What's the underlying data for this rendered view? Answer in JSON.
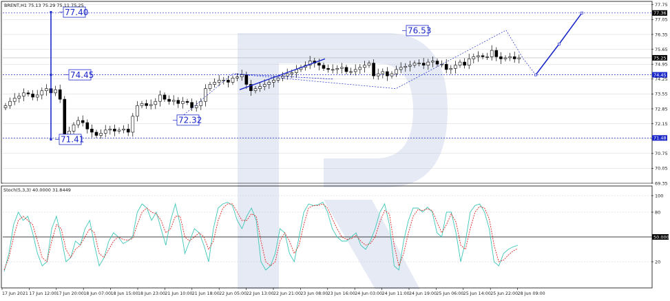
{
  "header": {
    "main_label": "BRENT,H1  75.13 75.29 75.11 75.25",
    "stoch_label": "Stoch(5,3,3) 40.0000 31.8449"
  },
  "colors": {
    "candle": "#000000",
    "level": "#1a27c9",
    "stoch_k": "#3cc7b7",
    "stoch_d": "#e0231c",
    "grid": "#c8c8c8",
    "watermark": "#e6eaf5"
  },
  "chart_data": [
    {
      "type": "candlestick",
      "title": "BRENT,H1",
      "ohlc_last": {
        "open": 75.13,
        "high": 75.29,
        "low": 75.11,
        "close": 75.25
      },
      "ylim": [
        69.35,
        77.84
      ],
      "y_ticks": [
        69.35,
        70.05,
        70.75,
        71.45,
        72.15,
        72.85,
        73.55,
        74.25,
        74.95,
        75.65,
        76.35,
        77.05,
        77.75
      ],
      "x_ticks": [
        "17 Jun 2021",
        "17 Jun 12:00",
        "17 Jun 20:00",
        "18 Jun 07:00",
        "18 Jun 15:00",
        "18 Jun 23:00",
        "21 Jun 10:00",
        "21 Jun 18:00",
        "22 Jun 05:00",
        "22 Jun 13:00",
        "22 Jun 21:00",
        "23 Jun 08:00",
        "23 Jun 16:00",
        "24 Jun 03:00",
        "24 Jun 11:00",
        "24 Jun 19:00",
        "25 Jun 06:00",
        "25 Jun 14:00",
        "25 Jun 22:00",
        "28 Jun 09:00"
      ],
      "price_labels": [
        {
          "price": 77.36,
          "text": "77.36"
        },
        {
          "price": 75.25,
          "text": "75.25"
        },
        {
          "price": 74.45,
          "text": "74.45"
        },
        {
          "price": 71.48,
          "text": "71.48"
        }
      ],
      "levels": [
        {
          "price": 77.36
        },
        {
          "price": 74.45
        },
        {
          "price": 71.48
        }
      ],
      "annotations": [
        {
          "text": "77.40",
          "price": 77.4
        },
        {
          "text": "74.45",
          "price": 74.45
        },
        {
          "text": "72.32",
          "price": 72.32
        },
        {
          "text": "71.41",
          "price": 71.41
        },
        {
          "text": "76.53",
          "price": 76.53
        }
      ],
      "closes": [
        73.0,
        73.2,
        73.35,
        73.45,
        73.6,
        73.55,
        73.4,
        73.5,
        73.7,
        73.8,
        73.6,
        73.75,
        73.3,
        71.6,
        71.8,
        72.1,
        72.3,
        72.2,
        71.9,
        71.75,
        71.6,
        71.7,
        71.85,
        71.9,
        71.8,
        71.85,
        71.9,
        71.75,
        72.5,
        73.0,
        73.1,
        73.0,
        73.05,
        73.2,
        73.5,
        73.3,
        73.2,
        73.25,
        73.1,
        73.2,
        73.15,
        72.9,
        73.0,
        73.2,
        73.8,
        74.0,
        74.1,
        74.2,
        74.2,
        74.1,
        74.3,
        74.35,
        74.45,
        74.0,
        73.7,
        73.8,
        73.9,
        74.0,
        74.1,
        74.2,
        74.3,
        74.4,
        74.5,
        74.55,
        74.7,
        74.8,
        74.9,
        75.1,
        75.0,
        74.9,
        74.75,
        74.7,
        74.7,
        74.75,
        74.8,
        74.6,
        74.6,
        74.7,
        74.8,
        74.9,
        75.0,
        74.4,
        74.5,
        74.6,
        74.4,
        74.5,
        74.7,
        74.8,
        74.85,
        74.9,
        75.0,
        75.0,
        74.9,
        75.05,
        75.1,
        74.95,
        74.95,
        74.7,
        74.75,
        74.9,
        75.05,
        74.9,
        75.2,
        75.3,
        75.35,
        75.3,
        75.3,
        75.6,
        75.3,
        75.2,
        75.25,
        75.3,
        75.2,
        75.25
      ],
      "forecast_path": [
        {
          "bar": 112,
          "price": 75.25
        },
        {
          "bar": 119,
          "price": 74.45
        },
        {
          "bar": 125,
          "price": 75.9
        },
        {
          "bar": 131,
          "price": 77.36
        }
      ]
    },
    {
      "type": "line",
      "title": "Stoch(5,3,3)",
      "values_header": [
        40.0,
        31.8449
      ],
      "ylim": [
        0,
        100
      ],
      "y_ticks": [
        100,
        80,
        50,
        20
      ],
      "reference_line": 50,
      "series": [
        {
          "values": [
            8,
            30,
            65,
            80,
            70,
            75,
            55,
            30,
            15,
            20,
            60,
            75,
            50,
            20,
            25,
            45,
            40,
            60,
            70,
            40,
            15,
            25,
            45,
            55,
            50,
            42,
            45,
            50,
            80,
            90,
            85,
            70,
            80,
            60,
            40,
            70,
            90,
            65,
            30,
            45,
            60,
            55,
            40,
            20,
            60,
            85,
            90,
            92,
            88,
            70,
            60,
            75,
            85,
            70,
            20,
            10,
            15,
            30,
            60,
            55,
            30,
            20,
            50,
            80,
            90,
            88,
            89,
            92,
            80,
            60,
            50,
            45,
            45,
            50,
            55,
            40,
            35,
            45,
            60,
            80,
            90,
            65,
            15,
            10,
            45,
            70,
            85,
            85,
            80,
            86,
            80,
            55,
            50,
            80,
            80,
            55,
            20,
            45,
            80,
            88,
            90,
            80,
            60,
            20,
            15,
            30,
            35,
            38,
            40
          ]
        },
        {
          "values": [
            10,
            25,
            50,
            70,
            75,
            70,
            65,
            45,
            25,
            20,
            45,
            65,
            60,
            35,
            25,
            35,
            40,
            50,
            60,
            55,
            30,
            25,
            35,
            45,
            50,
            47,
            46,
            48,
            65,
            80,
            85,
            80,
            78,
            70,
            55,
            60,
            75,
            75,
            50,
            45,
            50,
            55,
            50,
            35,
            45,
            70,
            85,
            90,
            90,
            80,
            70,
            70,
            78,
            75,
            45,
            20,
            15,
            20,
            45,
            55,
            45,
            30,
            40,
            65,
            85,
            88,
            88,
            90,
            85,
            72,
            60,
            50,
            47,
            48,
            52,
            45,
            40,
            42,
            50,
            68,
            82,
            78,
            40,
            15,
            30,
            55,
            75,
            83,
            82,
            84,
            82,
            68,
            55,
            65,
            78,
            68,
            40,
            35,
            60,
            80,
            87,
            85,
            72,
            40,
            20,
            22,
            28,
            33,
            36
          ]
        }
      ]
    }
  ]
}
